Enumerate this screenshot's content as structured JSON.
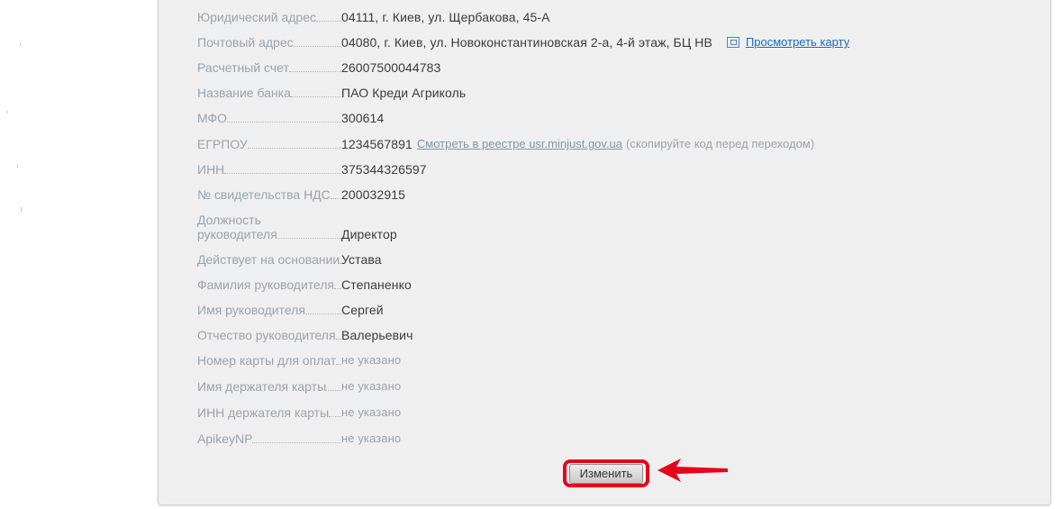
{
  "fields": [
    {
      "label": "Юридический адрес",
      "value": "04111, г. Киев, ул. Щербакова, 45-А"
    },
    {
      "label": "Почтовый адрес",
      "value": "04080, г. Киев, ул. Новоконстантиновская 2-а, 4-й этаж, БЦ НВ",
      "link": "Просмотреть карту",
      "icon": "map-icon"
    },
    {
      "label": "Расчетный счет",
      "value": "26007500044783"
    },
    {
      "label": "Название банка",
      "value": "ПАО Креди Агриколь"
    },
    {
      "label": "МФО",
      "value": "300614"
    },
    {
      "label": "ЕГРПОУ",
      "value": "1234567891",
      "link": "Смотреть в реестре usr.minjust.gov.ua",
      "note": "(скопируйте код перед переходом)"
    },
    {
      "label": "ИНН",
      "value": "375344326597"
    },
    {
      "label": "№ свидетельства НДС",
      "value": "200032915"
    },
    {
      "label_line1": "Должность",
      "label_line2": "руководителя",
      "value": "Директор"
    },
    {
      "label": "Действует на основании",
      "value": "Устава"
    },
    {
      "label": "Фамилия руководителя",
      "value": "Степаненко"
    },
    {
      "label": "Имя руководителя",
      "value": "Сергей"
    },
    {
      "label": "Отчество руководителя",
      "value": "Валерьевич"
    },
    {
      "label": "Номер карты для оплат",
      "value": "не указано"
    },
    {
      "label": "Имя держателя карты",
      "value": "не указано"
    },
    {
      "label": "ИНН держателя карты",
      "value": "не указано"
    },
    {
      "label": "ApikeyNP",
      "value": "не указано"
    }
  ],
  "edit_button": {
    "label": "Изменить"
  },
  "colors": {
    "highlight": "#e8001c",
    "label": "#9aa3ac",
    "value": "#3b3b3b",
    "link": "#1e6bb8"
  }
}
